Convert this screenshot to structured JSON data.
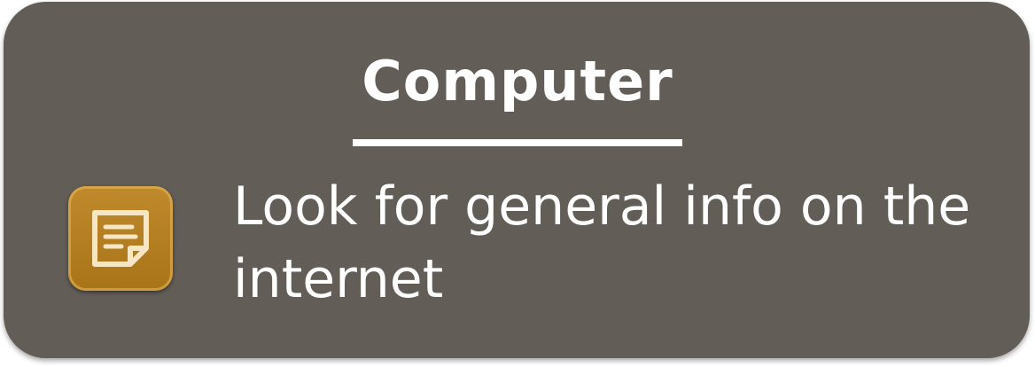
{
  "card": {
    "title": "Computer",
    "description": "Look for general info on the internet",
    "icon": "note-icon",
    "background_color": "#625d56",
    "icon_color": "#b37d20"
  }
}
